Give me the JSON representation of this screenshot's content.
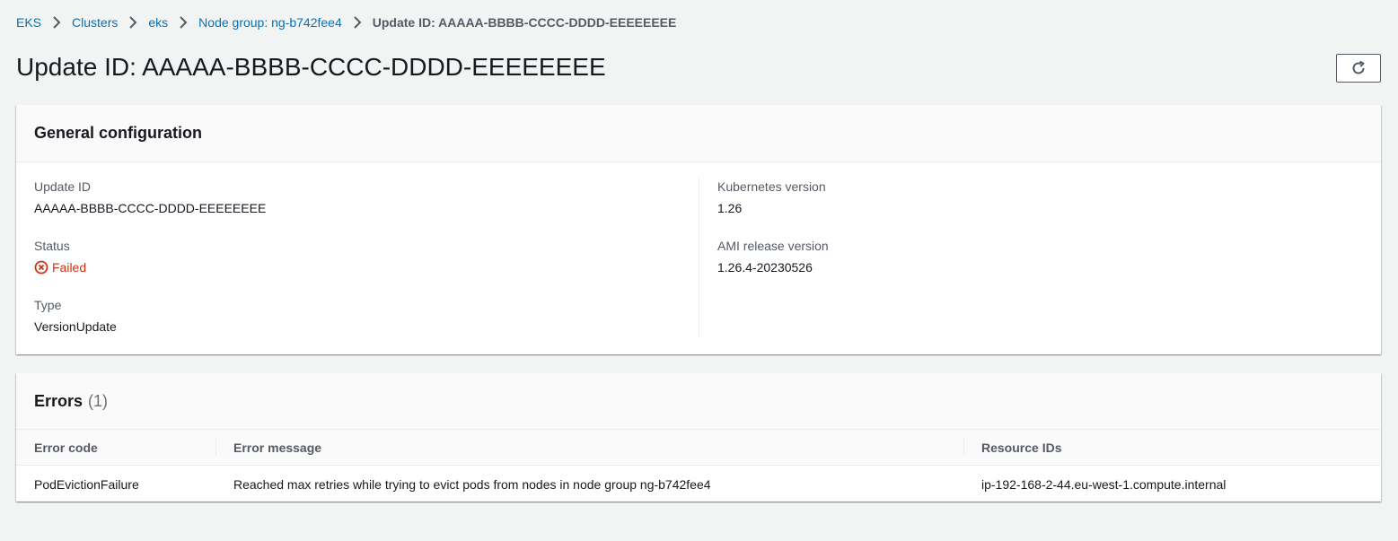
{
  "breadcrumb": {
    "items": [
      {
        "label": "EKS"
      },
      {
        "label": "Clusters"
      },
      {
        "label": "eks"
      },
      {
        "label": "Node group: ng-b742fee4"
      }
    ],
    "current": "Update ID: AAAAA-BBBB-CCCC-DDDD-EEEEEEEE"
  },
  "page": {
    "title": "Update ID: AAAAA-BBBB-CCCC-DDDD-EEEEEEEE",
    "refresh_icon": "refresh-icon"
  },
  "general": {
    "title": "General configuration",
    "update_id_label": "Update ID",
    "update_id_value": "AAAAA-BBBB-CCCC-DDDD-EEEEEEEE",
    "status_label": "Status",
    "status_value": "Failed",
    "status_icon": "error-circle-icon",
    "status_color": "#d13212",
    "type_label": "Type",
    "type_value": "VersionUpdate",
    "k8s_label": "Kubernetes version",
    "k8s_value": "1.26",
    "ami_label": "AMI release version",
    "ami_value": "1.26.4-20230526"
  },
  "errors": {
    "title": "Errors",
    "count": "(1)",
    "columns": [
      "Error code",
      "Error message",
      "Resource IDs"
    ],
    "rows": [
      {
        "code": "PodEvictionFailure",
        "message": "Reached max retries while trying to evict pods from nodes in node group ng-b742fee4",
        "resources": "ip-192-168-2-44.eu-west-1.compute.internal"
      }
    ]
  },
  "colors": {
    "link": "#0073bb",
    "background": "#f2f3f3",
    "error": "#d13212"
  }
}
